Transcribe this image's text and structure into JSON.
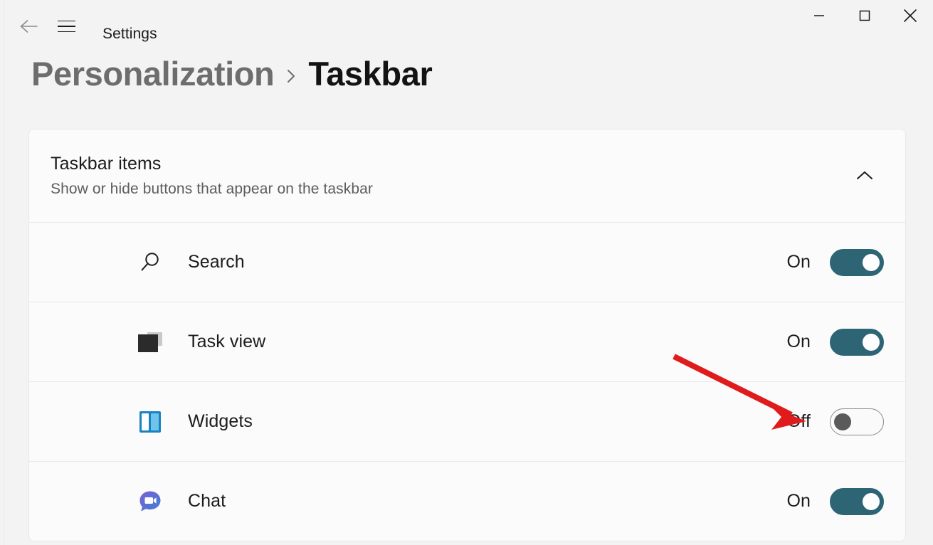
{
  "window": {
    "app_title": "Settings",
    "back_icon": "back-arrow-icon",
    "menu_icon": "hamburger-menu-icon",
    "controls": {
      "minimize": "minimize-icon",
      "maximize": "maximize-icon",
      "close": "close-icon"
    }
  },
  "breadcrumb": {
    "parent": "Personalization",
    "separator": "›",
    "current": "Taskbar"
  },
  "card": {
    "title": "Taskbar items",
    "subtitle": "Show or hide buttons that appear on the taskbar",
    "collapse_icon": "chevron-up-icon",
    "rows": [
      {
        "label": "Search",
        "icon": "search-icon",
        "state_label": "On",
        "state": "on"
      },
      {
        "label": "Task view",
        "icon": "task-view-icon",
        "state_label": "On",
        "state": "on"
      },
      {
        "label": "Widgets",
        "icon": "widgets-icon",
        "state_label": "Off",
        "state": "off"
      },
      {
        "label": "Chat",
        "icon": "chat-icon",
        "state_label": "On",
        "state": "on"
      }
    ]
  },
  "annotation": {
    "type": "arrow",
    "color": "#e01b1b",
    "points_at": "widgets-toggle"
  },
  "colors": {
    "page_background": "#f3f3f3",
    "card_background": "#fbfbfb",
    "toggle_on": "#2e6575",
    "toggle_off_knob": "#5a5a5a",
    "annotation_red": "#e01b1b",
    "breadcrumb_parent": "#6d6d6d",
    "breadcrumb_current": "#131313"
  }
}
